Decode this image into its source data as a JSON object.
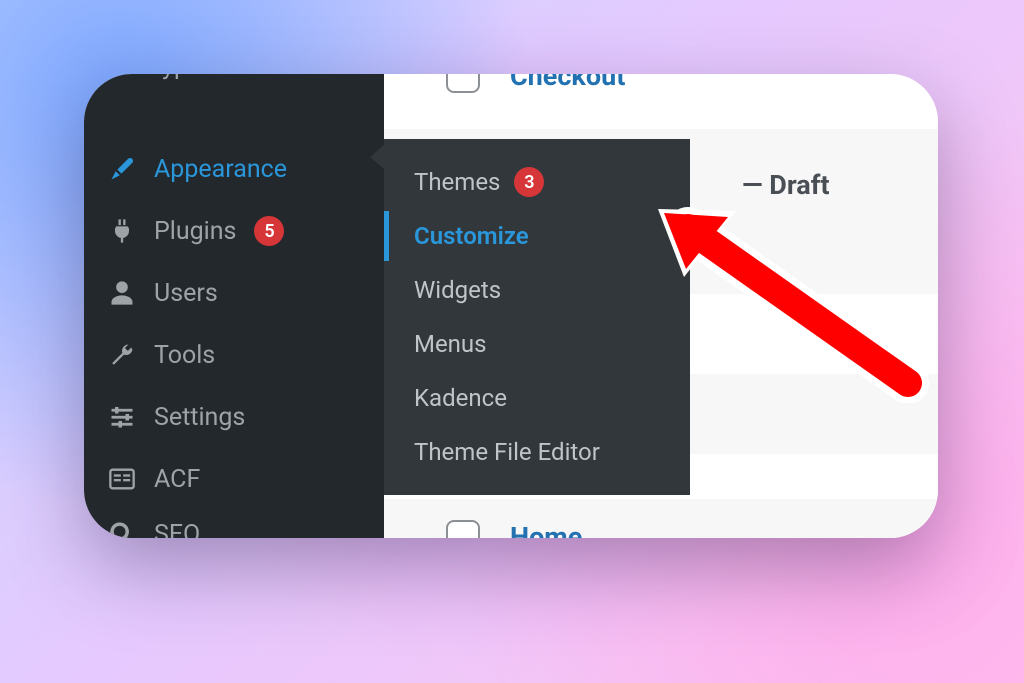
{
  "sidebar": {
    "items": [
      {
        "label": "type",
        "icon": ""
      },
      {
        "label": "Appearance",
        "icon": "brush",
        "active": true
      },
      {
        "label": "Plugins",
        "icon": "plug",
        "badge": "5"
      },
      {
        "label": "Users",
        "icon": "user"
      },
      {
        "label": "Tools",
        "icon": "wrench"
      },
      {
        "label": "Settings",
        "icon": "sliders"
      },
      {
        "label": "ACF",
        "icon": "acf"
      },
      {
        "label": "SEO",
        "icon": "seo"
      }
    ]
  },
  "submenu": {
    "items": [
      {
        "label": "Themes",
        "badge": "3"
      },
      {
        "label": "Customize",
        "active": true
      },
      {
        "label": "Widgets"
      },
      {
        "label": "Menus"
      },
      {
        "label": "Kadence"
      },
      {
        "label": "Theme File Editor"
      }
    ]
  },
  "content": {
    "rows": [
      {
        "title": "Checkout"
      },
      {
        "status_prefix": "— ",
        "status": "Draft",
        "alt": true
      },
      {
        "blank": true
      },
      {
        "blank": true,
        "alt": true
      },
      {
        "blank": true
      },
      {
        "title": "Home",
        "alt": true
      }
    ]
  },
  "colors": {
    "accent": "#2a97db",
    "badge": "#d63638"
  }
}
